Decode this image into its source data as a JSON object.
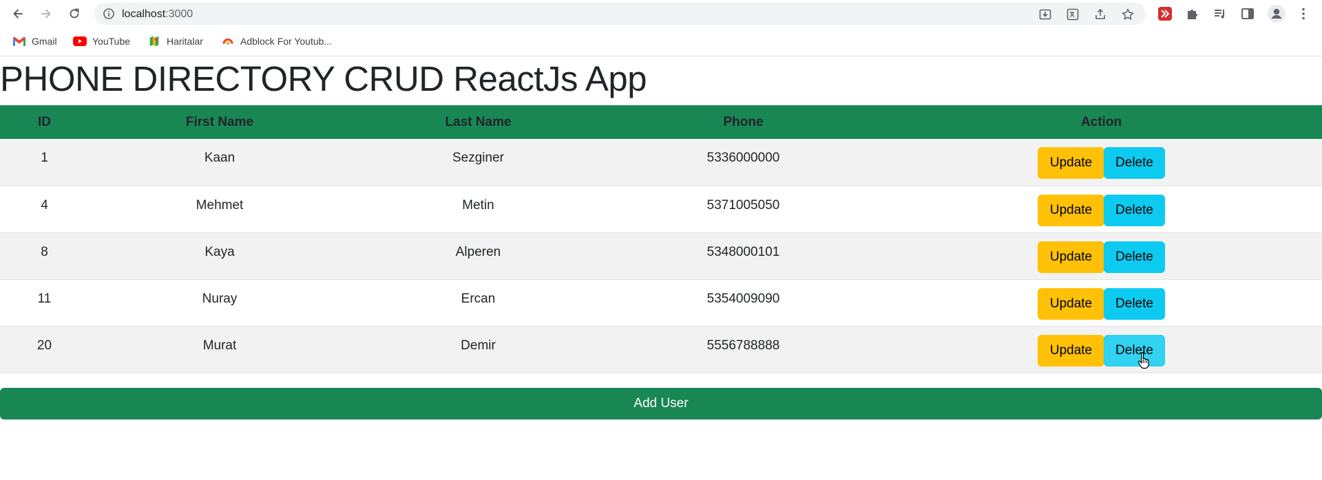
{
  "browser": {
    "url_host": "localhost",
    "url_port": ":3000",
    "bookmarks": [
      {
        "label": "Gmail",
        "icon": "gmail-icon"
      },
      {
        "label": "YouTube",
        "icon": "youtube-icon"
      },
      {
        "label": "Haritalar",
        "icon": "maps-icon"
      },
      {
        "label": "Adblock For Youtub...",
        "icon": "adblock-icon"
      }
    ]
  },
  "page": {
    "title": "PHONE DIRECTORY CRUD ReactJs App"
  },
  "table": {
    "headers": {
      "id": "ID",
      "first_name": "First Name",
      "last_name": "Last Name",
      "phone": "Phone",
      "action": "Action"
    },
    "rows": [
      {
        "id": "1",
        "first_name": "Kaan",
        "last_name": "Sezginer",
        "phone": "5336000000"
      },
      {
        "id": "4",
        "first_name": "Mehmet",
        "last_name": "Metin",
        "phone": "5371005050"
      },
      {
        "id": "8",
        "first_name": "Kaya",
        "last_name": "Alperen",
        "phone": "5348000101"
      },
      {
        "id": "11",
        "first_name": "Nuray",
        "last_name": "Ercan",
        "phone": "5354009090"
      },
      {
        "id": "20",
        "first_name": "Murat",
        "last_name": "Demir",
        "phone": "5556788888"
      }
    ],
    "update_label": "Update",
    "delete_label": "Delete"
  },
  "add_user_label": "Add User",
  "colors": {
    "header_green": "#198754",
    "update_yellow": "#ffc107",
    "delete_cyan": "#0dcaf0",
    "stripe": "#f2f2f2"
  }
}
